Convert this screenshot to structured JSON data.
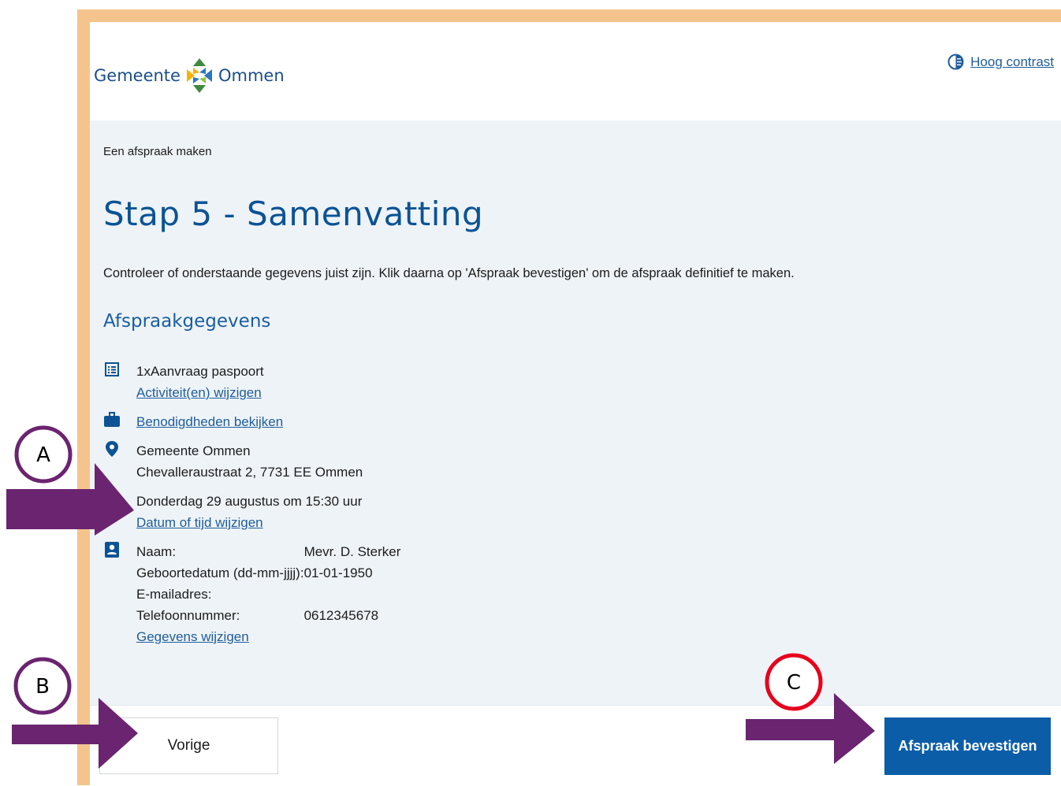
{
  "header": {
    "logo_left": "Gemeente",
    "logo_right": "Ommen",
    "high_contrast_label": "Hoog contrast"
  },
  "breadcrumb": "Een afspraak maken",
  "title": "Stap 5 - Samenvatting",
  "intro": "Controleer of onderstaande gegevens juist zijn. Klik daarna op 'Afspraak bevestigen' om de afspraak definitief te maken.",
  "section_title": "Afspraakgegevens",
  "activity": {
    "text": "1xAanvraag paspoort",
    "change_link": "Activiteit(en) wijzigen"
  },
  "requirements": {
    "link": "Benodigdheden bekijken"
  },
  "location": {
    "name": "Gemeente Ommen",
    "address": "Chevalleraustraat 2, 7731 EE Ommen"
  },
  "datetime": {
    "text": "Donderdag 29 augustus om 15:30 uur",
    "change_link": "Datum of tijd wijzigen"
  },
  "personal": {
    "rows": [
      {
        "label": "Naam:",
        "value": "Mevr. D. Sterker"
      },
      {
        "label": "Geboortedatum (dd-mm-jjjj):",
        "value": "01-01-1950"
      },
      {
        "label": "E-mailadres:",
        "value": ""
      },
      {
        "label": "Telefoonnummer:",
        "value": "0612345678"
      }
    ],
    "change_link": "Gegevens wijzigen"
  },
  "footer": {
    "prev_label": "Vorige",
    "confirm_label": "Afspraak bevestigen"
  },
  "annotations": {
    "a": "A",
    "b": "B",
    "c": "C"
  },
  "colors": {
    "frame": "#f5c48c",
    "brand_blue": "#0b5da8",
    "link_blue": "#1e5d9c",
    "arrow_purple": "#6b2470",
    "circle_c": "#e8001c"
  }
}
